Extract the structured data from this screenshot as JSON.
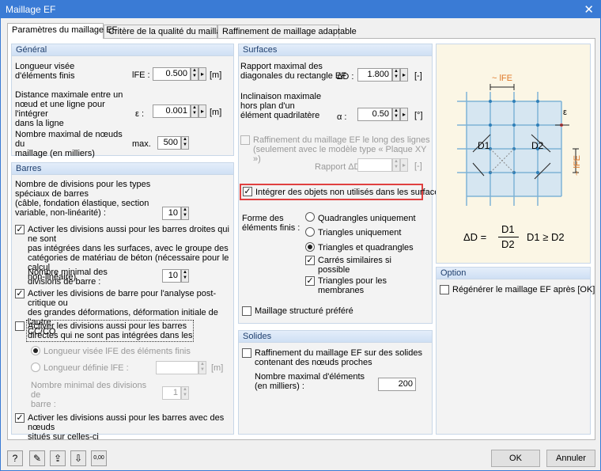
{
  "window": {
    "title": "Maillage EF",
    "close_glyph": "✕"
  },
  "tabs": [
    "Paramètres du maillage EF",
    "Critère de la qualité du maillage",
    "Raffinement de maillage adaptable"
  ],
  "general": {
    "header": "Général",
    "length_label": "Longueur visée\nd'éléments finis",
    "length_symbol": "lFE :",
    "length_value": "0.500",
    "length_unit": "[m]",
    "distance_label": "Distance maximale entre un\nnœud et une ligne pour l'intégrer\ndans la ligne",
    "distance_symbol": "ε :",
    "distance_value": "0.001",
    "distance_unit": "[m]",
    "nodes_label": "Nombre maximal de nœuds du\nmaillage (en milliers)",
    "nodes_symbol": "max.",
    "nodes_value": "500"
  },
  "barres": {
    "header": "Barres",
    "divisions_label": "Nombre de divisions pour les types\nspéciaux de barres\n(câble, fondation élastique, section\nvariable, non-linéarité) :",
    "divisions_value": "10",
    "cb1_label": "Activer les divisions aussi pour les barres droites qui ne sont\npas intégrées dans les surfaces, avec le groupe des\ncatégories de matériau de béton (nécessaire pour le calcul\nnon-linéaire)",
    "min_div_label": "Nombre minimal des\ndivisions de barre :",
    "min_div_value": "10",
    "cb2_label": "Activer les divisions de barre pour l'analyse post-critique ou\ndes grandes déformations, déformation initiale de l'autre\nCC/CO",
    "cb3_label": "Activer les divisions aussi pour les barres\ndirectes qui ne sont pas intégrées dans les",
    "radio1_label": "Longueur visée lFE des éléments finis",
    "radio2_label": "Longueur définie lFE :",
    "radio2_unit": "[m]",
    "min_div2_label": "Nombre minimal des divisions de\nbarre :",
    "min_div2_value": "1",
    "cb4_label": "Activer les divisions aussi pour les barres avec des nœuds\nsitués sur celles-ci"
  },
  "surfaces": {
    "header": "Surfaces",
    "ratio_label": "Rapport maximal des\ndiagonales du rectangle EF",
    "ratio_symbol": "ΔD :",
    "ratio_value": "1.800",
    "ratio_unit": "[-]",
    "incl_label": "Inclinaison maximale\nhors plan d'un\nélément quadrilatère",
    "incl_symbol": "α :",
    "incl_value": "0.50",
    "incl_unit": "[°]",
    "refine_label": "Raffinement du maillage EF le long des lignes\n(seulement avec le modèle type « Plaque XY »)",
    "rapport_label": "Rapport ΔD :",
    "rapport_unit": "[-]",
    "integrate_label": "Intégrer des objets non utilisés dans les surfaces",
    "forme_label": "Forme des\néléments finis :",
    "shape_options": [
      "Quadrangles uniquement",
      "Triangles uniquement",
      "Triangles et quadrangles"
    ],
    "similar_squares_label": "Carrés similaires si\npossible",
    "triangles_membranes_label": "Triangles pour les\nmembranes",
    "structured_label": "Maillage structuré préféré"
  },
  "solides": {
    "header": "Solides",
    "refine_label": "Raffinement du maillage EF sur des solides\ncontenant des nœuds proches",
    "max_elements_label": "Nombre maximal d'éléments\n(en milliers) :",
    "max_elements_value": "200"
  },
  "figure": {
    "lfe_top": "~ lFE",
    "lfe_side": "~ lFE",
    "epsilon": "ε",
    "d1": "D1",
    "d2": "D2",
    "formula_lhs": "ΔD =",
    "formula_num": "D1",
    "formula_den": "D2",
    "formula_rhs": "D1 ≥ D2"
  },
  "option": {
    "header": "Option",
    "regen_label": "Régénérer le maillage EF après [OK]"
  },
  "footer": {
    "ok_label": "OK",
    "cancel_label": "Annuler",
    "icons": [
      "help-icon",
      "edit-icon",
      "export-icon",
      "import-icon",
      "units-icon"
    ],
    "units_glyph": "0,00"
  },
  "colors": {
    "accent": "#3a7bd5",
    "highlight": "#e04040",
    "figure_bg": "#fbf6e5",
    "mesh": "#7fb3d6"
  }
}
